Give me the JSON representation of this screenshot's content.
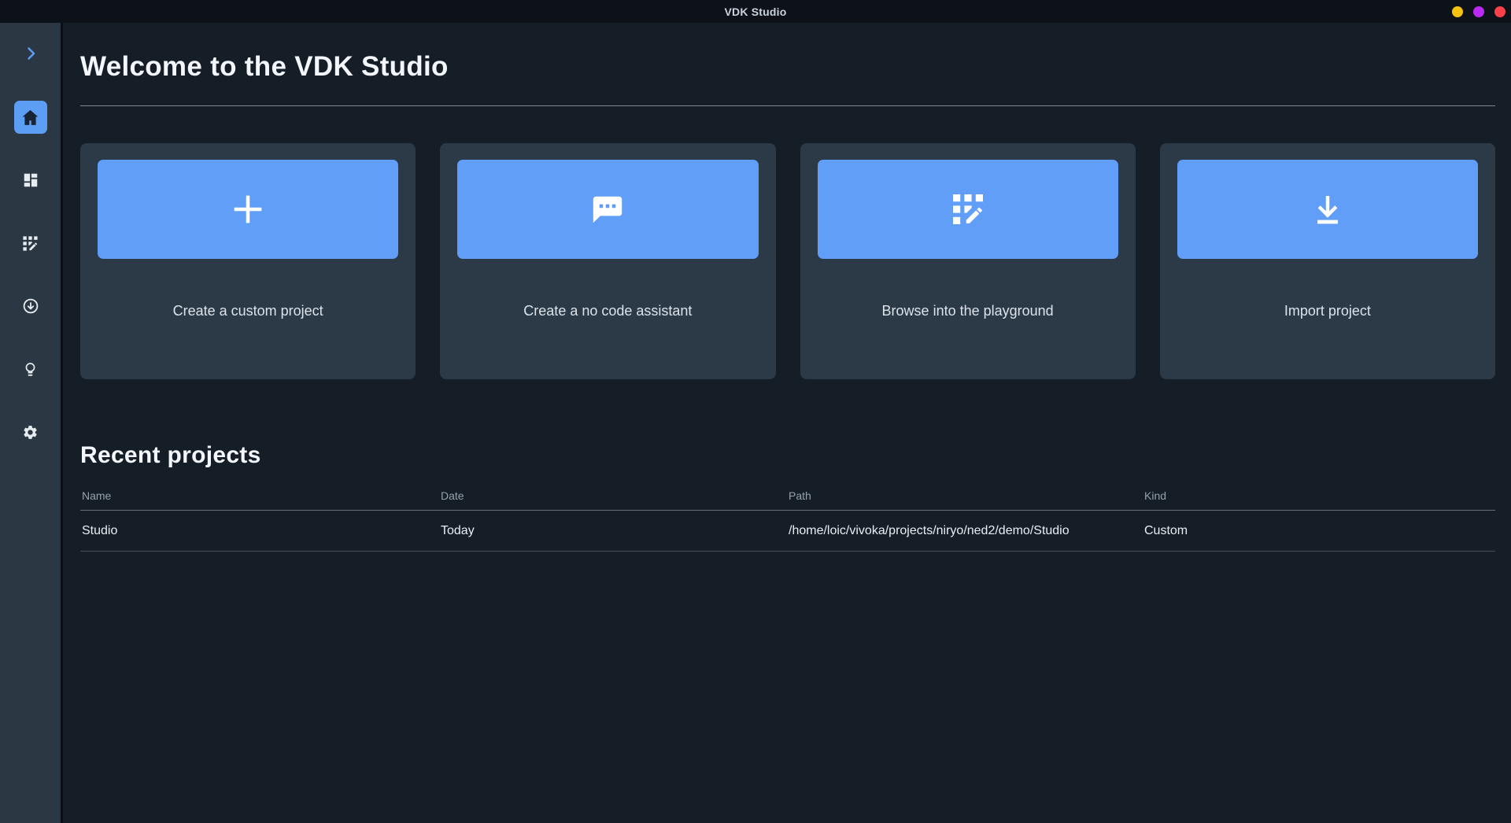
{
  "titlebar": {
    "title": "VDK Studio",
    "window_controls": [
      {
        "name": "control-yellow",
        "color": "#f5c211"
      },
      {
        "name": "control-purple",
        "color": "#bb2af2"
      },
      {
        "name": "control-red",
        "color": "#fb4049"
      }
    ]
  },
  "sidebar": {
    "items": [
      {
        "icon": "chevron-right-icon",
        "active": false
      },
      {
        "icon": "home-icon",
        "active": true
      },
      {
        "icon": "dashboard-icon",
        "active": false
      },
      {
        "icon": "grid-edit-icon",
        "active": false
      },
      {
        "icon": "arrow-circle-down-icon",
        "active": false
      },
      {
        "icon": "lightbulb-icon",
        "active": false
      },
      {
        "icon": "gear-icon",
        "active": false
      }
    ]
  },
  "main": {
    "heading": "Welcome to the VDK Studio",
    "cards": [
      {
        "label": "Create a custom project",
        "icon": "plus-icon"
      },
      {
        "label": "Create a no code assistant",
        "icon": "chat-icon"
      },
      {
        "label": "Browse into the playground",
        "icon": "grid-edit-icon"
      },
      {
        "label": "Import project",
        "icon": "download-icon"
      }
    ],
    "recent": {
      "heading": "Recent projects",
      "columns": [
        "Name",
        "Date",
        "Path",
        "Kind"
      ],
      "rows": [
        {
          "name": "Studio",
          "date": "Today",
          "path": "/home/loic/vivoka/projects/niryo/ned2/demo/Studio",
          "kind": "Custom"
        }
      ]
    }
  },
  "colors": {
    "accent_blue": "#619ef8",
    "active_tile_blue": "#5d9ef5",
    "background": "#151d26",
    "sidebar": "#2b3844",
    "card": "#2c3a48",
    "titlebar": "#0d1218"
  }
}
